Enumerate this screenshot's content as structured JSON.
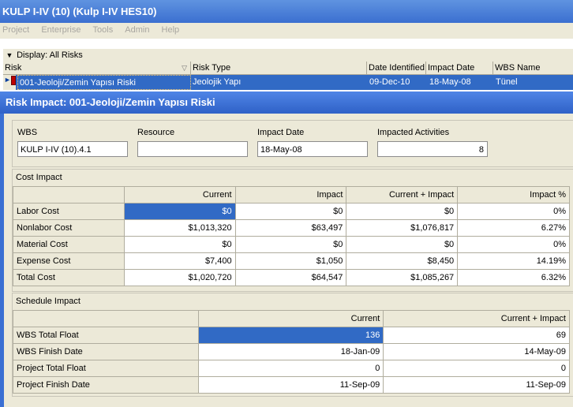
{
  "window": {
    "title": "KULP I-IV (10) (Kulp I-IV HES10)"
  },
  "menu": {
    "items": [
      "Project",
      "Enterprise",
      "Tools",
      "Admin",
      "Help"
    ]
  },
  "display_bar": {
    "label": "Display: All Risks"
  },
  "risk_grid": {
    "columns": [
      "Risk",
      "Risk Type",
      "Date Identified",
      "Impact Date",
      "WBS Name"
    ],
    "row": {
      "risk": "001-Jeoloji/Zemin Yapısı Riski",
      "risk_type": "Jeolojik Yapı",
      "date_identified": "09-Dec-10",
      "impact_date": "18-May-08",
      "wbs_name": "Tünel"
    }
  },
  "panel": {
    "title": "Risk Impact: 001-Jeoloji/Zemin Yapısı Riski",
    "fields": {
      "wbs_label": "WBS",
      "wbs_value": "KULP I-IV (10).4.1",
      "resource_label": "Resource",
      "resource_value": "",
      "impact_date_label": "Impact Date",
      "impact_date_value": "18-May-08",
      "impacted_activities_label": "Impacted Activities",
      "impacted_activities_value": "8"
    },
    "cost_impact": {
      "title": "Cost Impact",
      "headers": [
        "Current",
        "Impact",
        "Current + Impact",
        "Impact %"
      ],
      "rows": [
        {
          "label": "Labor Cost",
          "values": [
            "$0",
            "$0",
            "$0",
            "0%"
          ]
        },
        {
          "label": "Nonlabor Cost",
          "values": [
            "$1,013,320",
            "$63,497",
            "$1,076,817",
            "6.27%"
          ]
        },
        {
          "label": "Material Cost",
          "values": [
            "$0",
            "$0",
            "$0",
            "0%"
          ]
        },
        {
          "label": "Expense Cost",
          "values": [
            "$7,400",
            "$1,050",
            "$8,450",
            "14.19%"
          ]
        },
        {
          "label": "Total Cost",
          "values": [
            "$1,020,720",
            "$64,547",
            "$1,085,267",
            "6.32%"
          ]
        }
      ]
    },
    "schedule_impact": {
      "title": "Schedule Impact",
      "headers": [
        "Current",
        "Current + Impact"
      ],
      "rows": [
        {
          "label": "WBS Total Float",
          "values": [
            "136",
            "69"
          ]
        },
        {
          "label": "WBS Finish Date",
          "values": [
            "18-Jan-09",
            "14-May-09"
          ]
        },
        {
          "label": "Project Total Float",
          "values": [
            "0",
            "0"
          ]
        },
        {
          "label": "Project Finish Date",
          "values": [
            "11-Sep-09",
            "11-Sep-09"
          ]
        }
      ]
    }
  }
}
